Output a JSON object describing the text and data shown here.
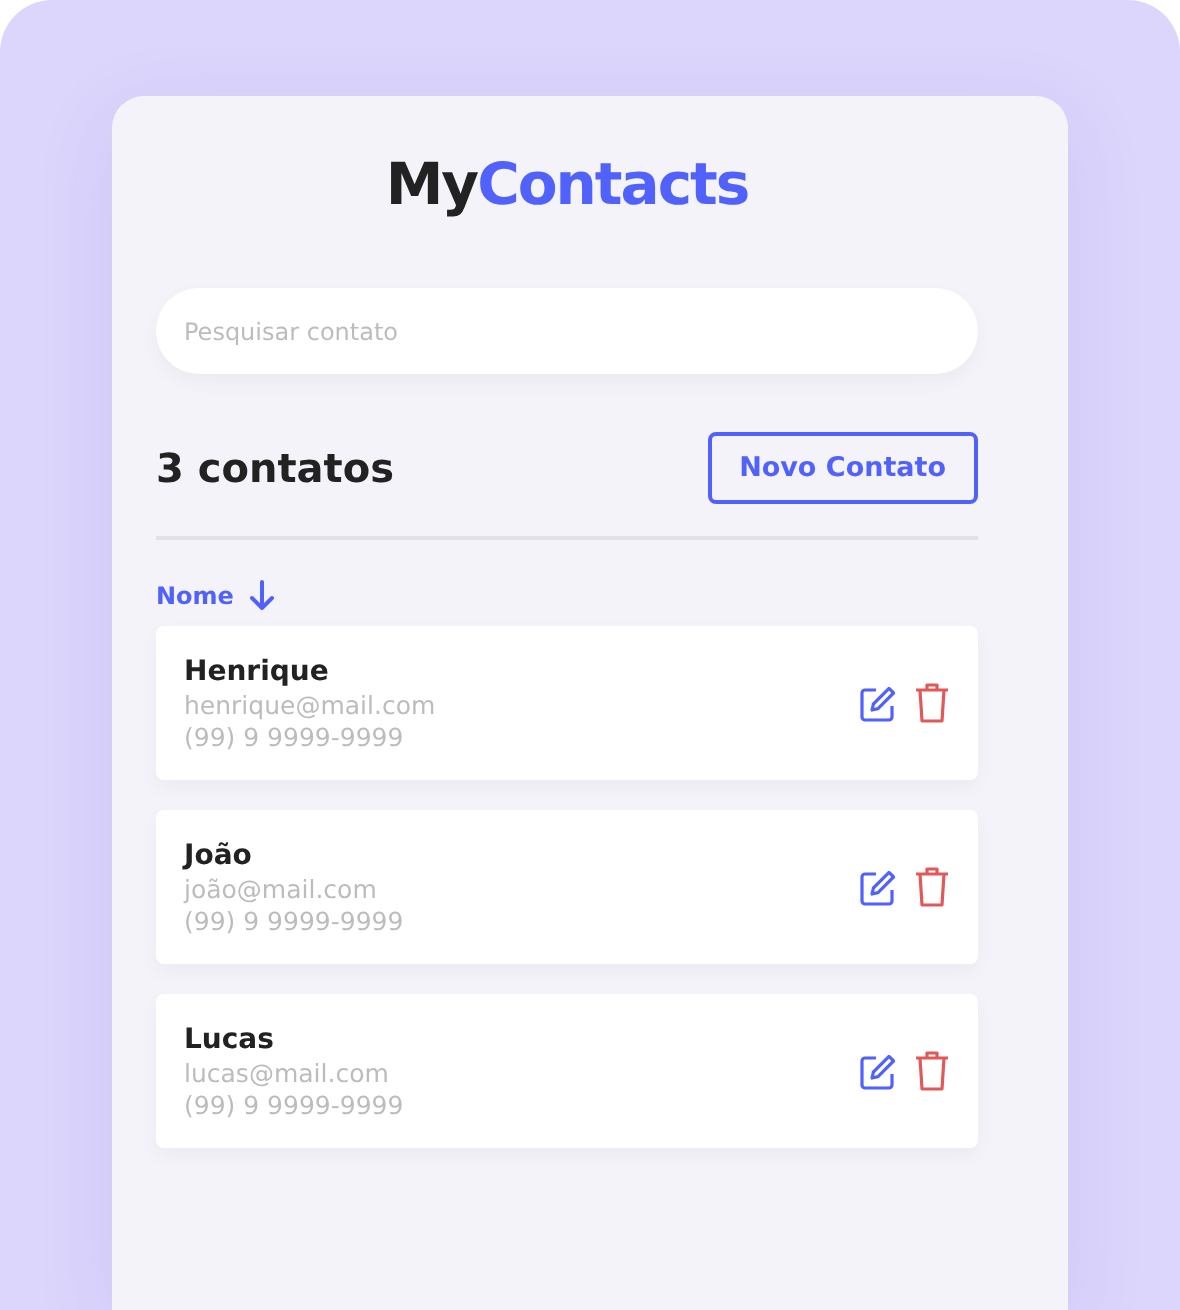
{
  "logo": {
    "dark": "My",
    "accent": "Contacts"
  },
  "search": {
    "placeholder": "Pesquisar contato"
  },
  "header": {
    "count": "3 contatos",
    "new_button": "Novo Contato"
  },
  "sort": {
    "label": "Nome",
    "descending": true
  },
  "contacts": [
    {
      "name": "Henrique",
      "email": "henrique@mail.com",
      "phone": "(99) 9 9999-9999"
    },
    {
      "name": "João",
      "email": "joão@mail.com",
      "phone": "(99) 9 9999-9999"
    },
    {
      "name": "Lucas",
      "email": "lucas@mail.com",
      "phone": "(99) 9 9999-9999"
    }
  ]
}
